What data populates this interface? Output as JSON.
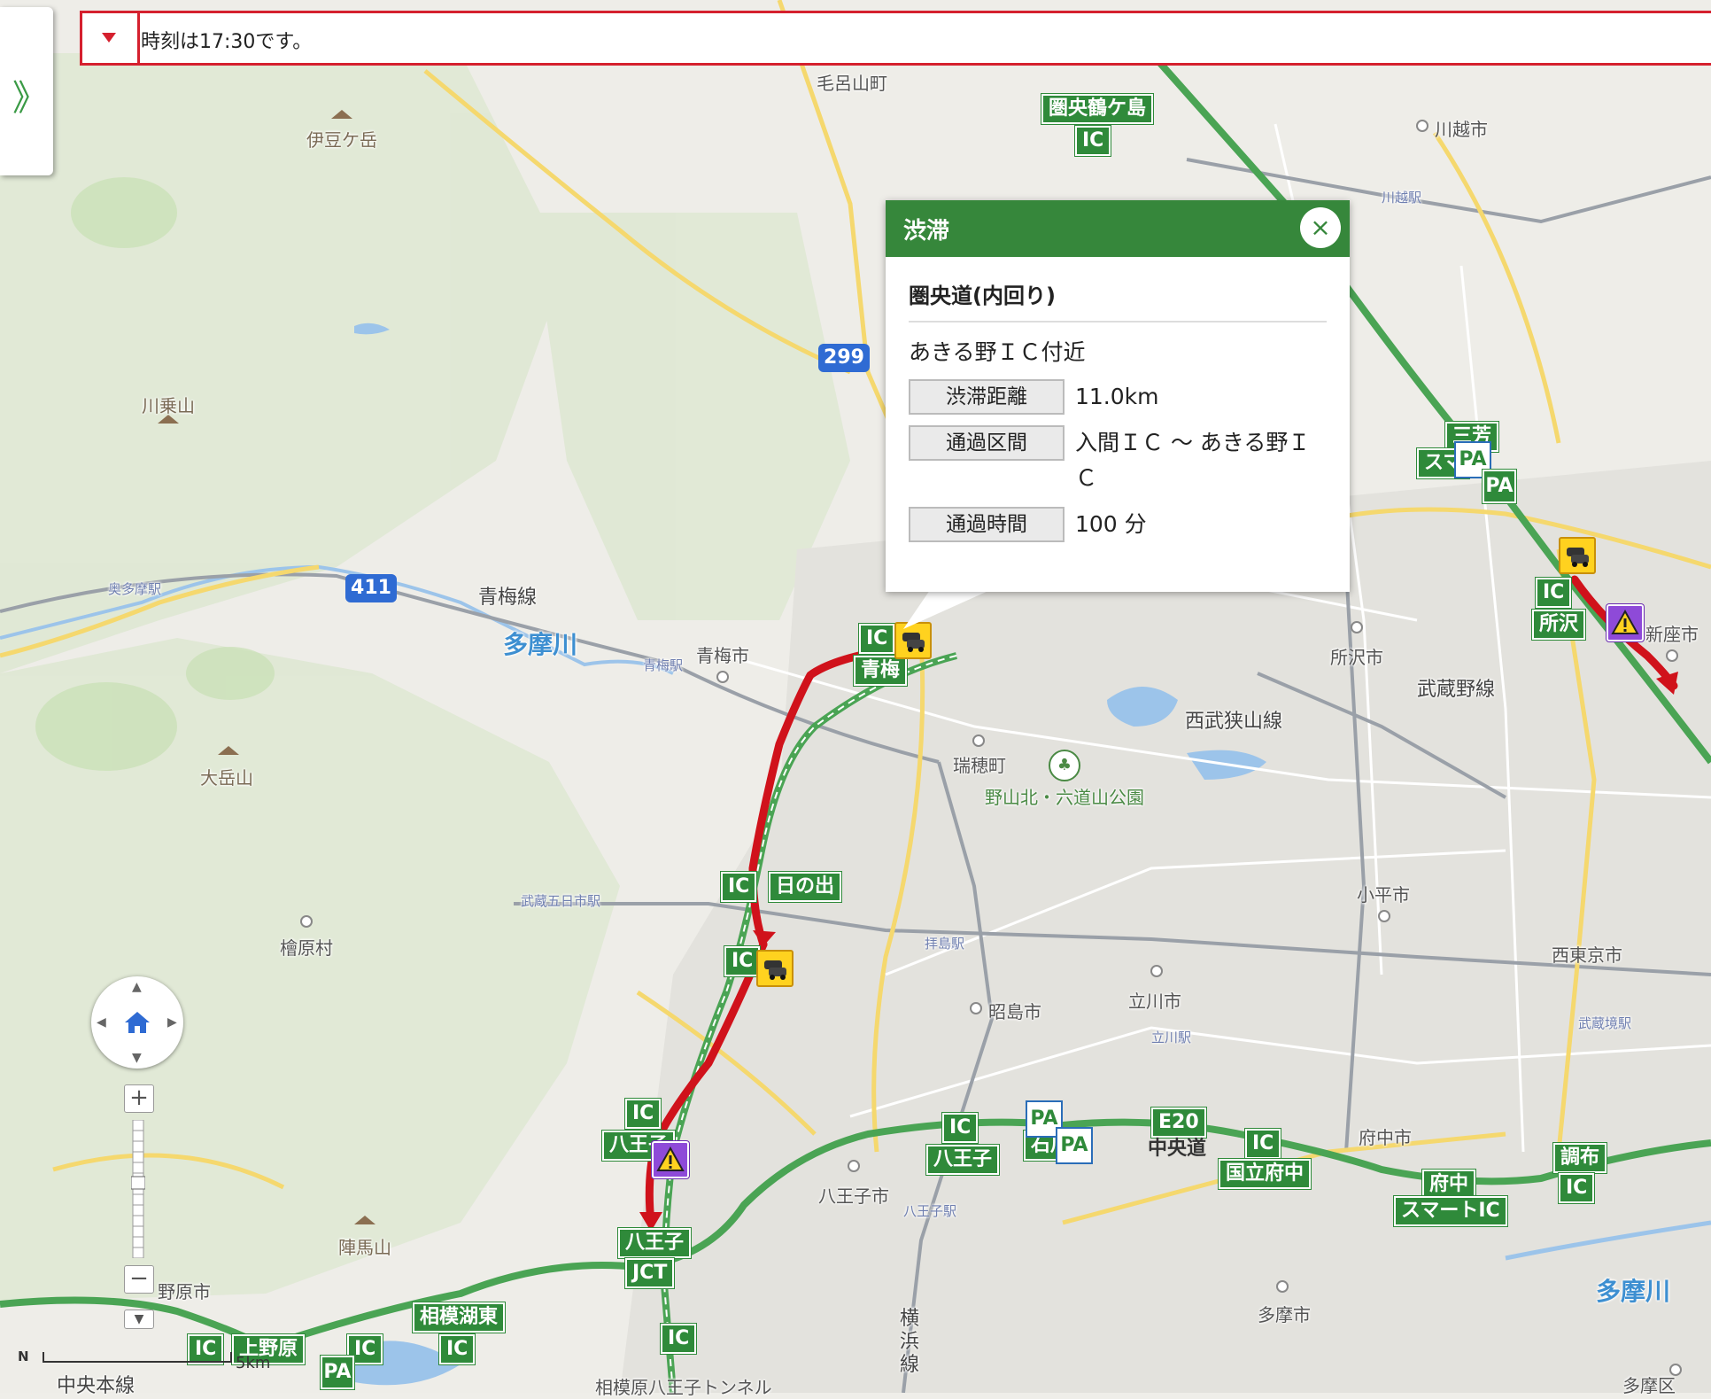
{
  "topbar": {
    "message": "時刻は17:30です。"
  },
  "side_panel": {
    "toggle_glyph": "》"
  },
  "popup": {
    "title": "渋滞",
    "close_glyph": "×",
    "road_name": "圏央道(内回り)",
    "location": "あきる野ＩＣ付近",
    "rows": [
      {
        "label": "渋滞距離",
        "value": "11.0km"
      },
      {
        "label": "通過区間",
        "value": "入間ＩＣ 〜 あきる野ＩＣ"
      },
      {
        "label": "通過時間",
        "value": "100 分"
      }
    ]
  },
  "map": {
    "places": {
      "kemoyamachi": "毛呂山町",
      "izugatake": "伊豆ケ岳",
      "kawakoshi": "川越市",
      "kawakoshi_eki": "川越駅",
      "kawanoriyama": "川乗山",
      "okutama_eki": "奥多摩駅",
      "omesen": "青梅線",
      "tamagawa1": "多摩川",
      "omeshi": "青梅市",
      "ome_eki": "青梅駅",
      "tokorozawa_shi": "所沢市",
      "musashinosen": "武蔵野線",
      "niiza": "新座市",
      "seibusayamasen": "西武狭山線",
      "mizuho": "瑞穂町",
      "sayamapark": "野山北・六道山公園",
      "odake": "大岳山",
      "musashi_itsukaichi": "武蔵五日市駅",
      "kodaira": "小平市",
      "nishitokyo": "西東京市",
      "hinohara": "檜原村",
      "haijima": "拝島駅",
      "akishima": "昭島市",
      "tachikawa": "立川市",
      "tachikawa_eki": "立川駅",
      "musashisakai": "武蔵境駅",
      "hachioji_shi": "八王子市",
      "hachioji_eki": "八王子駅",
      "fuchu_shi": "府中市",
      "jinbasan": "陣馬山",
      "noharashi": "野原市",
      "tama_shi": "多摩市",
      "tamagawa2": "多摩川",
      "chuohonsen": "中央本線",
      "sagamihara_tunnel": "相模原八王子トンネル",
      "yokohamasen": "横浜線",
      "tamaku": "多摩区"
    },
    "route_shields": {
      "r299": "299",
      "r411": "411"
    },
    "highway_labels": {
      "kenoudoturugashima": "圏央鶴ケ島",
      "ic": "IC",
      "ome": "青梅",
      "hinode": "日の出",
      "hachioji": "八王子",
      "jct": "JCT",
      "sagamikohigashi": "相模湖東",
      "uenohara": "上野原",
      "tokorozawa": "所沢",
      "miyoshi": "三芳",
      "sma": "スマ",
      "e20": "E20",
      "chuodo": "中央道",
      "kunitachifuchu": "国立府中",
      "fuchu": "府中",
      "smart_ic": "スマートIC",
      "chofu": "調布",
      "ishikawa": "石川",
      "pa": "PA"
    },
    "scale": {
      "label": "5km",
      "north": "N"
    }
  },
  "colors": {
    "highway": "#2f8a3a",
    "congestion": "#d0121b",
    "accent_red": "#d5202e",
    "popup_header": "#36873b"
  },
  "icons": [
    "chevron-double-right-icon",
    "dropdown-triangle-icon",
    "close-icon",
    "home-icon",
    "traffic-jam-icon",
    "warning-icon",
    "parking-area-icon",
    "mountain-icon",
    "station-icon",
    "park-icon"
  ]
}
